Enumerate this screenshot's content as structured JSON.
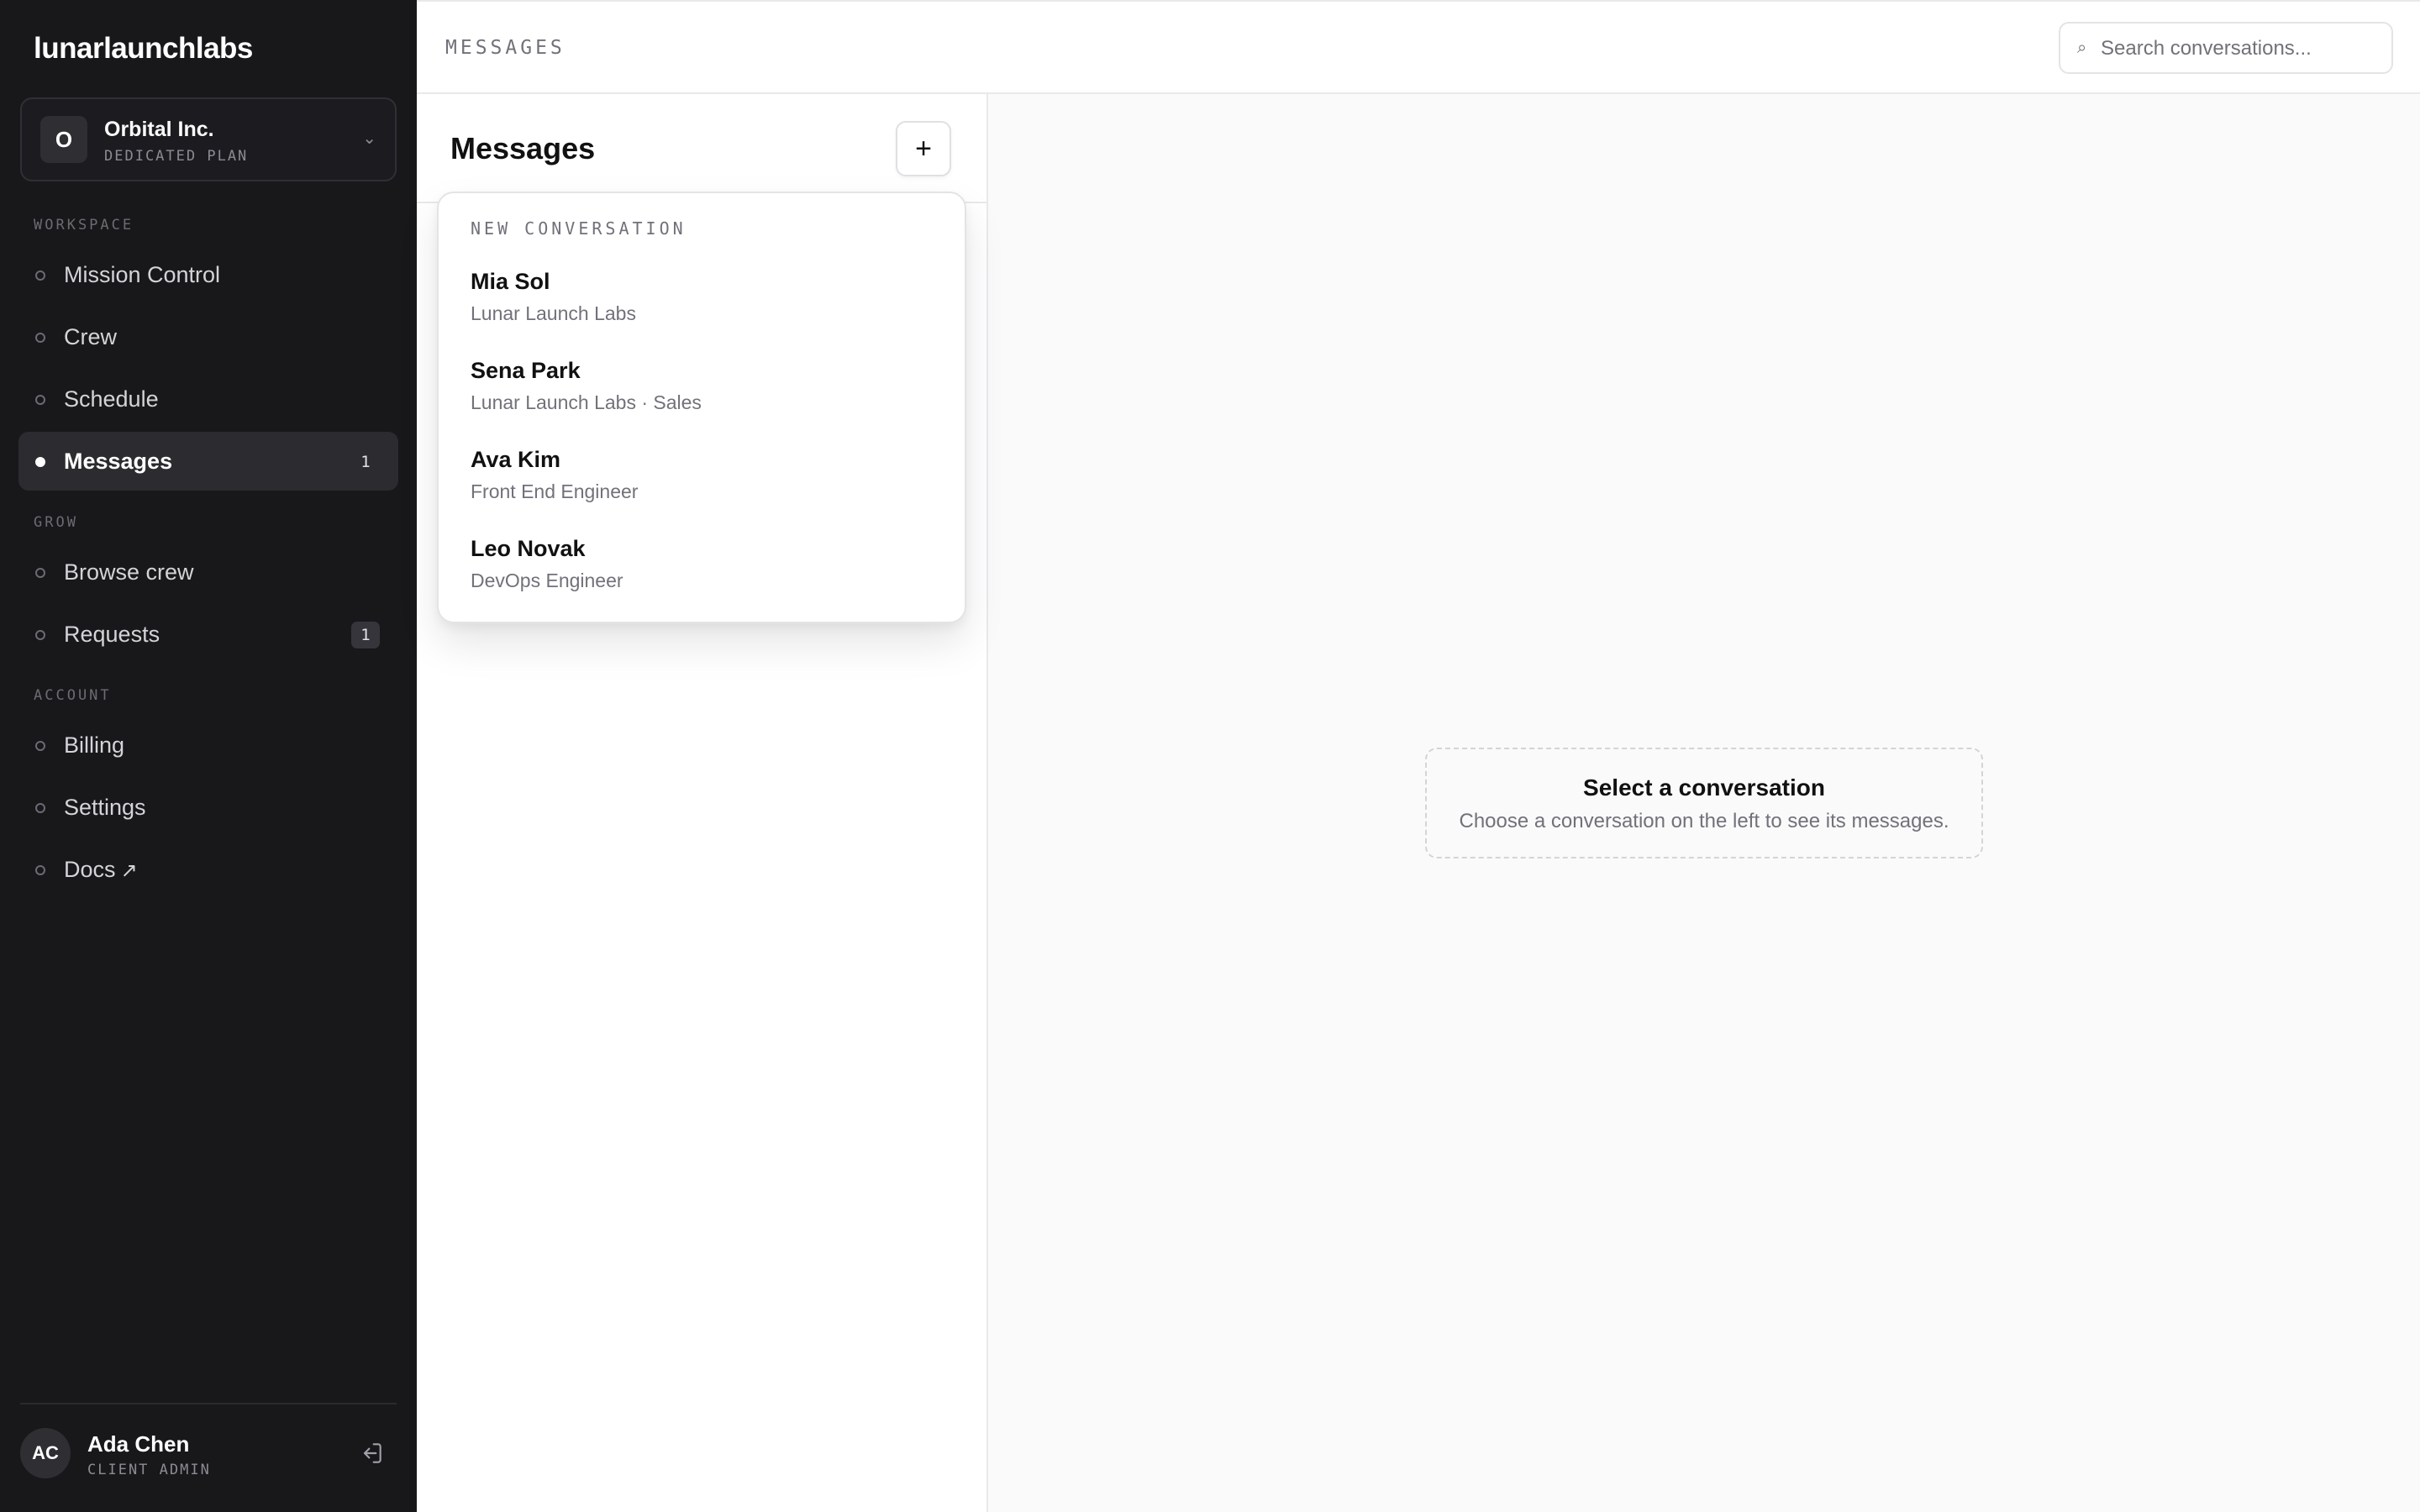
{
  "sidebar": {
    "brand": "lunarlaunchlabs",
    "org": {
      "initial": "O",
      "name": "Orbital Inc.",
      "plan": "DEDICATED PLAN"
    },
    "sections": {
      "workspace": "WORKSPACE",
      "grow": "GROW",
      "account": "ACCOUNT"
    },
    "items": [
      {
        "label": "Mission Control"
      },
      {
        "label": "Crew"
      },
      {
        "label": "Schedule"
      },
      {
        "label": "Messages",
        "badge": "1",
        "active": true
      },
      {
        "label": "Browse crew"
      },
      {
        "label": "Requests",
        "badge": "1"
      },
      {
        "label": "Billing"
      },
      {
        "label": "Settings"
      },
      {
        "label": "Docs",
        "external": true
      }
    ],
    "user": {
      "initials": "AC",
      "name": "Ada Chen",
      "role": "CLIENT ADMIN"
    }
  },
  "topbar": {
    "title": "MESSAGES",
    "search_placeholder": "Search conversations..."
  },
  "messages_panel": {
    "title": "Messages",
    "new_button": "+"
  },
  "new_conversation": {
    "header": "NEW CONVERSATION",
    "contacts": [
      {
        "name": "Mia Sol",
        "subtitle": "Lunar Launch Labs"
      },
      {
        "name": "Sena Park",
        "subtitle": "Lunar Launch Labs · Sales"
      },
      {
        "name": "Ava Kim",
        "subtitle": "Front End Engineer"
      },
      {
        "name": "Leo Novak",
        "subtitle": "DevOps Engineer"
      }
    ]
  },
  "empty_state": {
    "title": "Select a conversation",
    "subtitle": "Choose a conversation on the left to see its messages."
  },
  "colors": {
    "sidebar_bg": "#18181b",
    "active_item_bg": "#2b2b30",
    "content_bg": "#fafafa"
  }
}
